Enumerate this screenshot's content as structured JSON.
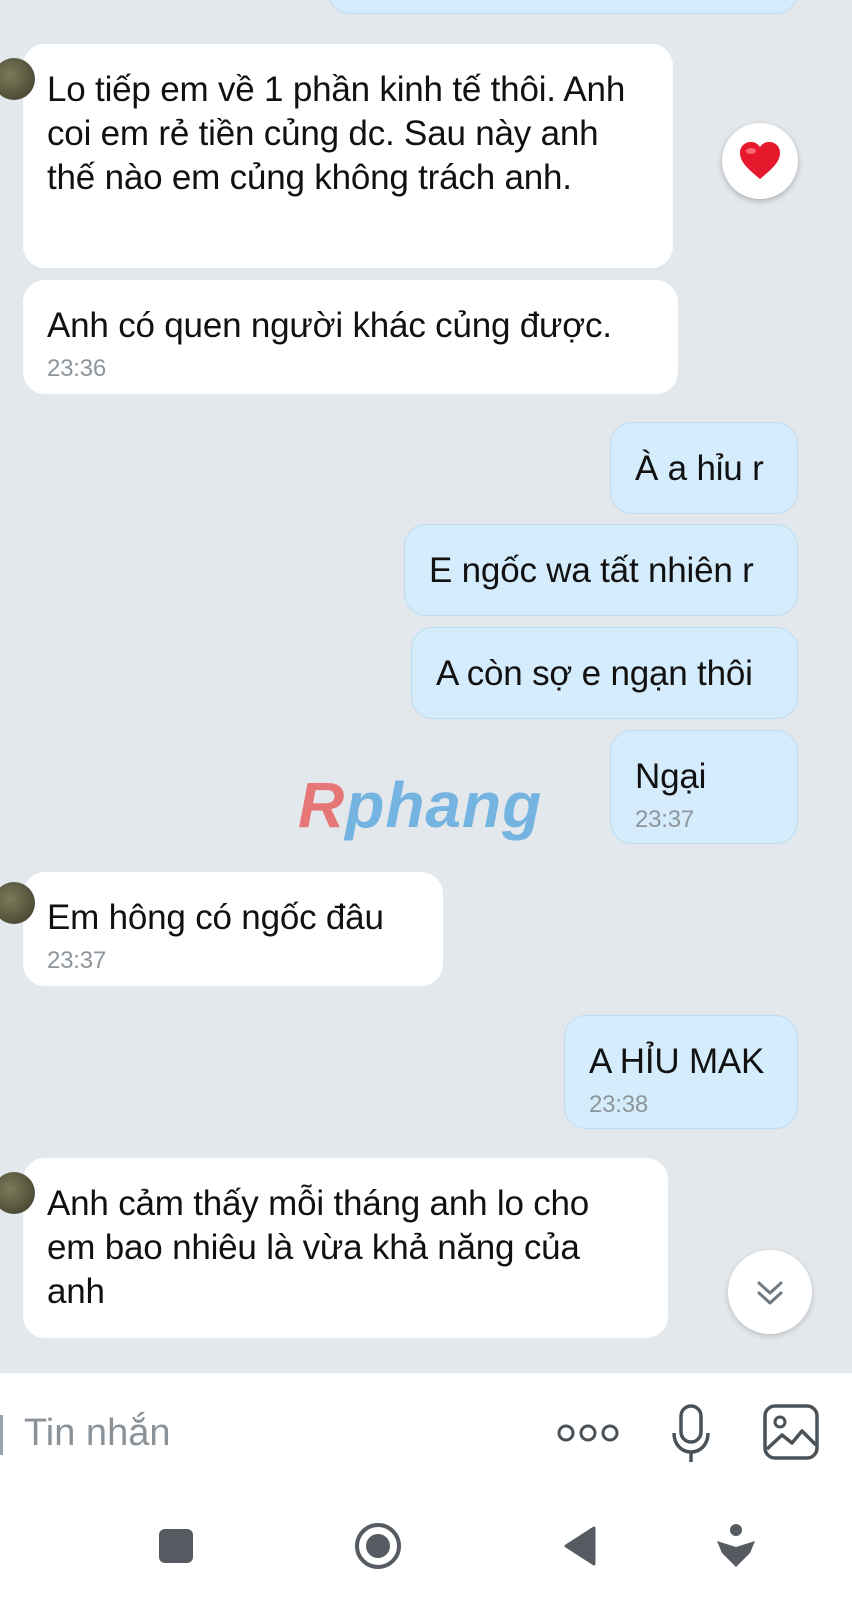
{
  "messages": [
    {
      "side": "in",
      "text": "Lo tiếp em về 1 phần kinh tế thôi. Anh coi em rẻ tiền củng dc. Sau này anh thế nào em củng không trách anh.",
      "time": ""
    },
    {
      "side": "in",
      "text": "Anh có quen người khác củng được.",
      "time": "23:36"
    },
    {
      "side": "out",
      "text": "À a hỉu r",
      "time": ""
    },
    {
      "side": "out",
      "text": "E ngốc wa tất nhiên r",
      "time": ""
    },
    {
      "side": "out",
      "text": "A còn sợ e ngạn thôi",
      "time": ""
    },
    {
      "side": "out",
      "text": "Ngại",
      "time": "23:37"
    },
    {
      "side": "in",
      "text": "Em hông có ngốc đâu",
      "time": "23:37"
    },
    {
      "side": "out",
      "text": "A HỈU MAK",
      "time": "23:38"
    },
    {
      "side": "in",
      "text": "Anh cảm thấy mỗi tháng anh lo cho em bao nhiêu là vừa khả năng của anh",
      "time": ""
    }
  ],
  "watermark": {
    "first": "R",
    "rest": "phang"
  },
  "composer": {
    "placeholder": "Tin nhắn"
  },
  "colors": {
    "incoming": "#ffffff",
    "outgoing": "#d4ecfb",
    "background": "#e3e8ed",
    "heart": "#e5192b"
  },
  "icons": [
    "heart-icon",
    "scroll-down-icon",
    "more-icon",
    "microphone-icon",
    "image-icon",
    "recent-apps-icon",
    "home-icon",
    "back-icon",
    "assistant-icon"
  ]
}
